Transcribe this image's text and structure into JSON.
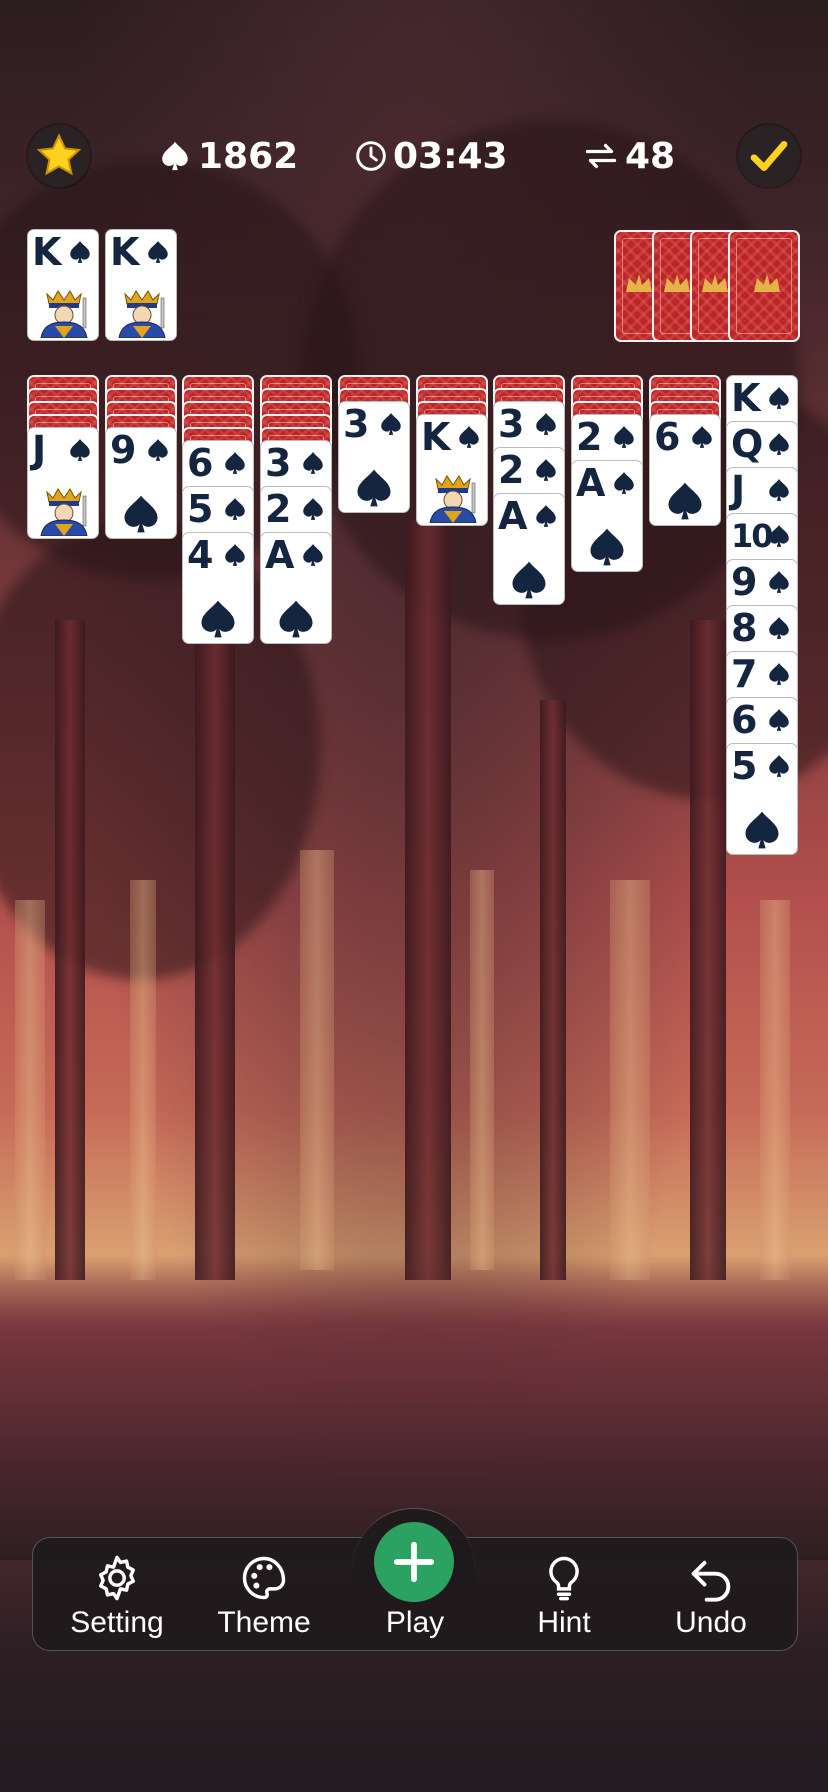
{
  "top_bar": {
    "score": "1862",
    "timer": "03:43",
    "moves": "48",
    "icons": {
      "favorite": "star-icon",
      "score": "spade-icon",
      "timer": "clock-icon",
      "moves": "swap-icon",
      "done": "checkmark-icon"
    }
  },
  "foundation_completed": [
    {
      "rank": "K",
      "suit": "spade"
    },
    {
      "rank": "K",
      "suit": "spade"
    }
  ],
  "stock": {
    "remaining_deals": 4
  },
  "tableau": [
    {
      "face_down": 4,
      "face_up": [
        "J"
      ]
    },
    {
      "face_down": 4,
      "face_up": [
        "9"
      ]
    },
    {
      "face_down": 5,
      "face_up": [
        "6",
        "5",
        "4"
      ]
    },
    {
      "face_down": 5,
      "face_up": [
        "3",
        "2",
        "A"
      ]
    },
    {
      "face_down": 2,
      "face_up": [
        "3"
      ]
    },
    {
      "face_down": 3,
      "face_up": [
        "K"
      ]
    },
    {
      "face_down": 2,
      "face_up": [
        "3",
        "2",
        "A"
      ]
    },
    {
      "face_down": 3,
      "face_up": [
        "2",
        "A"
      ]
    },
    {
      "face_down": 3,
      "face_up": [
        "6"
      ]
    },
    {
      "face_down": 0,
      "face_up": [
        "K",
        "Q",
        "J",
        "10",
        "9",
        "8",
        "7",
        "6",
        "5"
      ]
    }
  ],
  "toolbar": {
    "setting": "Setting",
    "theme": "Theme",
    "play": "Play",
    "hint": "Hint",
    "undo": "Undo"
  },
  "colors": {
    "card_ink": "#142540",
    "card_back": "#b8262a",
    "play_button": "#2ca262",
    "star": "#ffd21f"
  }
}
